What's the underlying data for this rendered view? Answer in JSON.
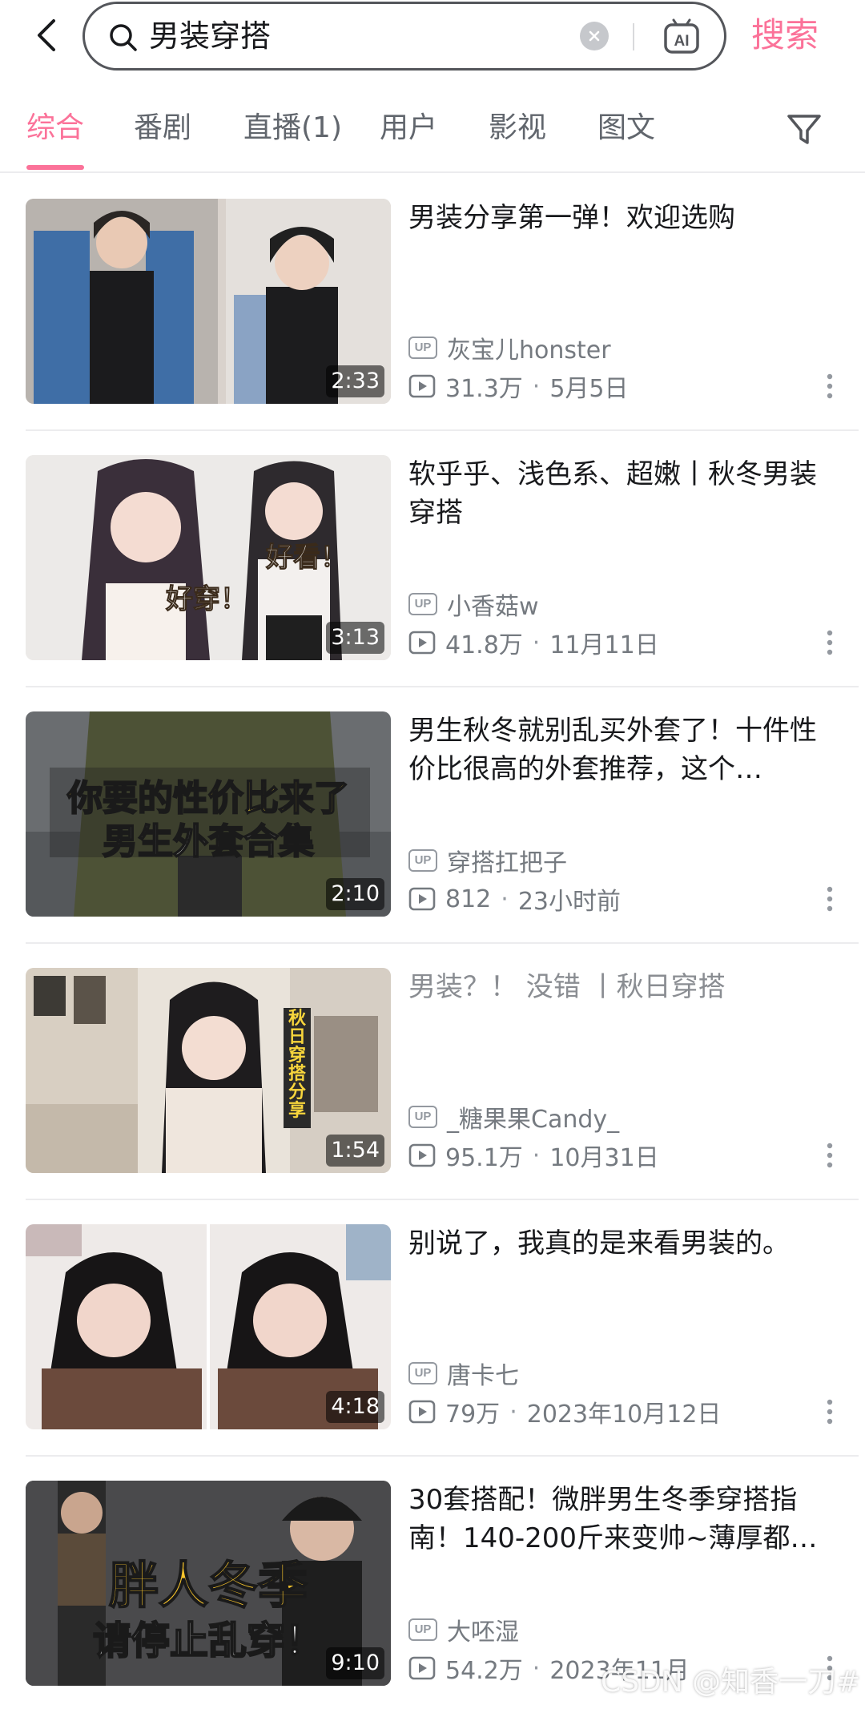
{
  "search": {
    "query": "男装穿搭",
    "submit_label": "搜索",
    "back_icon": "chevron-left-icon",
    "search_icon": "search-icon",
    "clear_icon": "clear-icon",
    "ai_icon": "ai-assistant-icon",
    "ai_label": "AI"
  },
  "tabs": [
    {
      "label": "综合",
      "active": true
    },
    {
      "label": "番剧"
    },
    {
      "label": "直播(1)"
    },
    {
      "label": "用户"
    },
    {
      "label": "影视"
    },
    {
      "label": "图文"
    }
  ],
  "filter_icon": "filter-icon",
  "accent_color": "#fb7299",
  "up_badge": "UP",
  "results": [
    {
      "title": "男装分享第一弹！欢迎选购",
      "uploader": "灰宝儿honster",
      "views": "31.3万",
      "date": "5月5日",
      "duration": "2:33"
    },
    {
      "title": "软乎乎、浅色系、超嫩丨秋冬男装穿搭",
      "uploader": "小香菇w",
      "views": "41.8万",
      "date": "11月11日",
      "duration": "3:13",
      "thumb_text_1": "好看！",
      "thumb_text_2": "好穿！"
    },
    {
      "title": "男生秋冬就别乱买外套了！十件性价比很高的外套推荐，这个…",
      "uploader": "穿搭扛把子",
      "views": "812",
      "date": "23小时前",
      "duration": "2:10",
      "thumb_text_1": "你要的性价比来了",
      "thumb_text_2": "男生外套合集"
    },
    {
      "title": "男装？！ 没错 丨秋日穿搭",
      "uploader": "_糖果果Candy_",
      "views": "95.1万",
      "date": "10月31日",
      "duration": "1:54",
      "visited": true,
      "thumb_text_1": "秋日穿搭分享"
    },
    {
      "title": "别说了，我真的是来看男装的。",
      "uploader": "唐卡七",
      "views": "79万",
      "date": "2023年10月12日",
      "duration": "4:18"
    },
    {
      "title": "30套搭配！微胖男生冬季穿搭指南！140-200斤来变帅~薄厚都…",
      "uploader": "大呸湿",
      "views": "54.2万",
      "date": "2023年11月",
      "duration": "9:10",
      "thumb_text_1": "胖人冬季",
      "thumb_text_2": "请停止乱穿！"
    }
  ],
  "watermark": "CSDN @知香一刀#"
}
